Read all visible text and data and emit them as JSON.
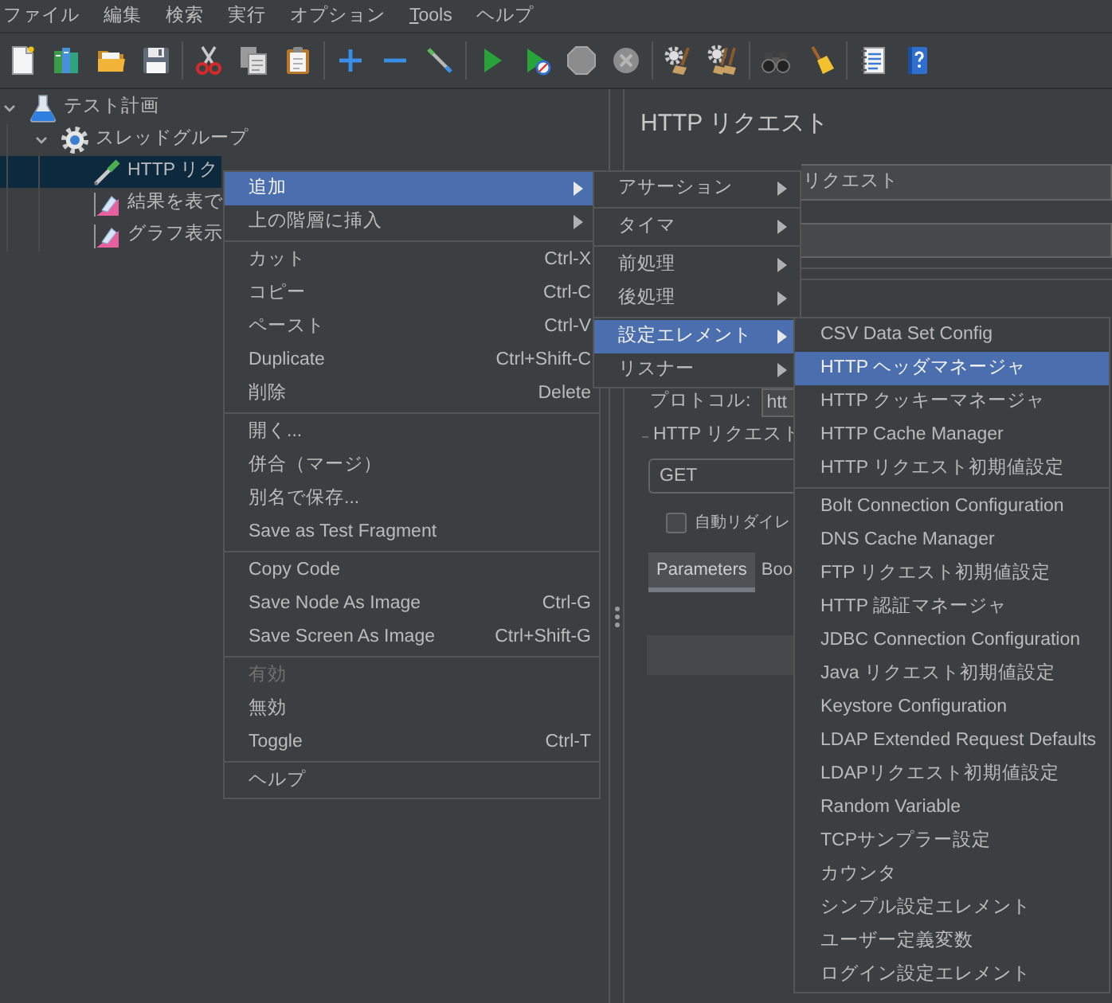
{
  "menu_bar": [
    {
      "label": "ファイル",
      "mnemonic": false
    },
    {
      "label": "編集",
      "mnemonic": false
    },
    {
      "label": "検索",
      "mnemonic": false
    },
    {
      "label": "実行",
      "mnemonic": false
    },
    {
      "label": "オプション",
      "mnemonic": false
    },
    {
      "label": "Tools",
      "mnemonic": true
    },
    {
      "label": "ヘルプ",
      "mnemonic": false
    }
  ],
  "toolbar": [
    [
      {
        "kind": "new",
        "disabled": false
      },
      {
        "kind": "templates",
        "disabled": false
      },
      {
        "kind": "open",
        "disabled": false
      },
      {
        "kind": "save",
        "disabled": false
      }
    ],
    [
      {
        "kind": "cut",
        "disabled": false
      },
      {
        "kind": "copy",
        "disabled": false
      },
      {
        "kind": "paste",
        "disabled": false
      }
    ],
    [
      {
        "kind": "add",
        "disabled": false
      },
      {
        "kind": "remove",
        "disabled": false
      },
      {
        "kind": "toggle",
        "disabled": false
      }
    ],
    [
      {
        "kind": "start",
        "disabled": false
      },
      {
        "kind": "start_no_pauses",
        "disabled": false
      },
      {
        "kind": "stop",
        "disabled": true
      },
      {
        "kind": "shutdown",
        "disabled": true
      }
    ],
    [
      {
        "kind": "clear",
        "disabled": false
      },
      {
        "kind": "clear_all",
        "disabled": false
      }
    ],
    [
      {
        "kind": "search",
        "disabled": false
      },
      {
        "kind": "reset_search",
        "disabled": false
      }
    ],
    [
      {
        "kind": "function_helper",
        "disabled": false
      },
      {
        "kind": "help",
        "disabled": false
      }
    ]
  ],
  "tree": [
    {
      "label": "テスト計画",
      "kind": "test_plan",
      "expanded": true,
      "selected": false,
      "children": [
        {
          "label": "スレッドグループ",
          "kind": "thread_group",
          "expanded": true,
          "selected": false,
          "children": [
            {
              "label": "HTTP リク",
              "kind": "sampler",
              "selected": true
            },
            {
              "label": "結果を表で",
              "kind": "listener",
              "selected": false
            },
            {
              "label": "グラフ表示",
              "kind": "listener",
              "selected": false
            }
          ]
        }
      ]
    }
  ],
  "editor": {
    "title": "HTTP リクエスト",
    "name_field": {
      "value": "リクエスト"
    },
    "protocol": {
      "label": "プロトコル:",
      "value": "htt"
    },
    "request_group": {
      "title": "HTTP リクエスト",
      "method": "GET",
      "redirect": {
        "label": "自動リダイレ",
        "checked": false
      }
    },
    "tabs": [
      {
        "label": "Parameters",
        "selected": true
      },
      {
        "label": "Boo",
        "selected": false
      }
    ]
  },
  "context_menu": {
    "sections": [
      [
        {
          "label": "追加",
          "has_submenu": true,
          "selected": true,
          "disabled": false
        },
        {
          "label": "上の階層に挿入",
          "has_submenu": true,
          "selected": false,
          "disabled": false
        }
      ],
      [
        {
          "label": "カット",
          "shortcut": "Ctrl-X",
          "has_submenu": false,
          "selected": false,
          "disabled": false
        },
        {
          "label": "コピー",
          "shortcut": "Ctrl-C",
          "has_submenu": false,
          "selected": false,
          "disabled": false
        },
        {
          "label": "ペースト",
          "shortcut": "Ctrl-V",
          "has_submenu": false,
          "selected": false,
          "disabled": false
        },
        {
          "label": "Duplicate",
          "shortcut": "Ctrl+Shift-C",
          "has_submenu": false,
          "selected": false,
          "disabled": false
        },
        {
          "label": "削除",
          "shortcut": "Delete",
          "has_submenu": false,
          "selected": false,
          "disabled": false
        }
      ],
      [
        {
          "label": "開く...",
          "has_submenu": false,
          "selected": false,
          "disabled": false
        },
        {
          "label": "併合（マージ）",
          "has_submenu": false,
          "selected": false,
          "disabled": false
        },
        {
          "label": "別名で保存...",
          "has_submenu": false,
          "selected": false,
          "disabled": false
        },
        {
          "label": "Save as Test Fragment",
          "has_submenu": false,
          "selected": false,
          "disabled": false
        }
      ],
      [
        {
          "label": "Copy Code",
          "has_submenu": false,
          "selected": false,
          "disabled": false
        },
        {
          "label": "Save Node As Image",
          "shortcut": "Ctrl-G",
          "has_submenu": false,
          "selected": false,
          "disabled": false
        },
        {
          "label": "Save Screen As Image",
          "shortcut": "Ctrl+Shift-G",
          "has_submenu": false,
          "selected": false,
          "disabled": false
        }
      ],
      [
        {
          "label": "有効",
          "has_submenu": false,
          "selected": false,
          "disabled": true
        },
        {
          "label": "無効",
          "has_submenu": false,
          "selected": false,
          "disabled": false
        },
        {
          "label": "Toggle",
          "shortcut": "Ctrl-T",
          "has_submenu": false,
          "selected": false,
          "disabled": false
        }
      ],
      [
        {
          "label": "ヘルプ",
          "has_submenu": false,
          "selected": false,
          "disabled": false
        }
      ]
    ]
  },
  "add_submenu": {
    "sections": [
      [
        {
          "label": "アサーション",
          "has_submenu": true,
          "selected": false
        }
      ],
      [
        {
          "label": "タイマ",
          "has_submenu": true,
          "selected": false
        }
      ],
      [
        {
          "label": "前処理",
          "has_submenu": true,
          "selected": false
        },
        {
          "label": "後処理",
          "has_submenu": true,
          "selected": false
        }
      ],
      [
        {
          "label": "設定エレメント",
          "has_submenu": true,
          "selected": true
        },
        {
          "label": "リスナー",
          "has_submenu": true,
          "selected": false
        }
      ]
    ]
  },
  "config_submenu": {
    "sections": [
      [
        {
          "label": "CSV Data Set Config",
          "selected": false
        },
        {
          "label": "HTTP ヘッダマネージャ",
          "selected": true
        },
        {
          "label": "HTTP クッキーマネージャ",
          "selected": false
        },
        {
          "label": "HTTP Cache Manager",
          "selected": false
        },
        {
          "label": "HTTP リクエスト初期値設定",
          "selected": false
        }
      ],
      [
        {
          "label": "Bolt Connection Configuration",
          "selected": false
        },
        {
          "label": "DNS Cache Manager",
          "selected": false
        },
        {
          "label": "FTP リクエスト初期値設定",
          "selected": false
        },
        {
          "label": "HTTP 認証マネージャ",
          "selected": false
        },
        {
          "label": "JDBC Connection Configuration",
          "selected": false
        },
        {
          "label": "Java リクエスト初期値設定",
          "selected": false
        },
        {
          "label": "Keystore Configuration",
          "selected": false
        },
        {
          "label": "LDAP Extended Request Defaults",
          "selected": false
        },
        {
          "label": "LDAPリクエスト初期値設定",
          "selected": false
        },
        {
          "label": "Random Variable",
          "selected": false
        },
        {
          "label": "TCPサンプラー設定",
          "selected": false
        },
        {
          "label": "カウンタ",
          "selected": false
        },
        {
          "label": "シンプル設定エレメント",
          "selected": false
        },
        {
          "label": "ユーザー定義変数",
          "selected": false
        },
        {
          "label": "ログイン設定エレメント",
          "selected": false
        }
      ]
    ]
  }
}
